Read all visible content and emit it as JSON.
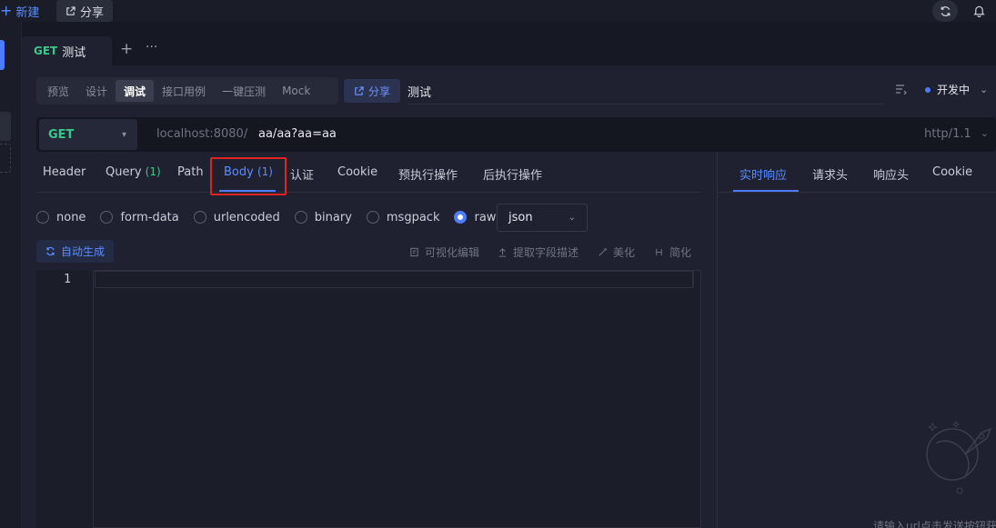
{
  "topbar": {
    "new_label": "新建",
    "share_label": "分享"
  },
  "tab": {
    "method": "GET",
    "title": "测试",
    "add": "+",
    "more": "···"
  },
  "modes": [
    "预览",
    "设计",
    "调试",
    "接口用例",
    "一键压测",
    "Mock"
  ],
  "active_mode": "调试",
  "share_label": "分享",
  "api_name": "测试",
  "status": "开发中",
  "request": {
    "method": "GET",
    "base_url": "localhost:8080/",
    "path": "aa/aa?aa=aa",
    "http_version": "http/1.1"
  },
  "request_tabs": {
    "header": "Header",
    "query": "Query",
    "query_count": "(1)",
    "path": "Path",
    "body": "Body",
    "body_count": "(1)",
    "auth": "认证",
    "cookie": "Cookie",
    "pre": "预执行操作",
    "post": "后执行操作"
  },
  "body_types": {
    "none": "none",
    "form_data": "form-data",
    "urlencoded": "urlencoded",
    "binary": "binary",
    "msgpack": "msgpack",
    "raw": "raw"
  },
  "selected_body_type": "raw",
  "format": "json",
  "toolbar": {
    "auto_generate": "自动生成",
    "visual_edit": "可视化编辑",
    "extract_desc": "提取字段描述",
    "beautify": "美化",
    "simplify": "简化"
  },
  "editor": {
    "line_number": "1"
  },
  "response_tabs": {
    "realtime": "实时响应",
    "req_headers": "请求头",
    "resp_headers": "响应头",
    "cookie": "Cookie"
  },
  "response_hint": "请输入url点击发送按钮获取",
  "colors": {
    "accent": "#4f7cff",
    "get_method": "#3ac88a",
    "highlight": "#e02424"
  }
}
